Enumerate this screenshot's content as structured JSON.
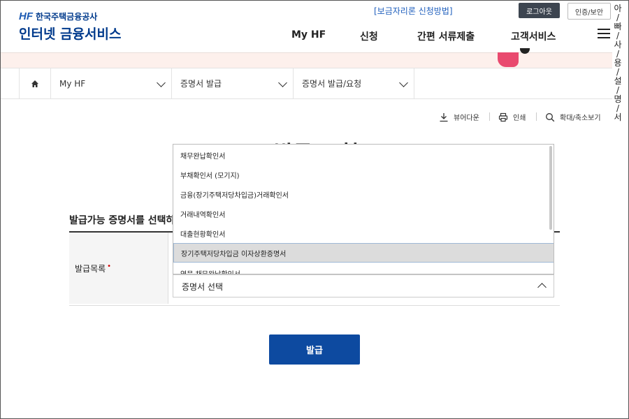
{
  "header": {
    "logo_mark": "HF",
    "org_name": "한국주택금융공사",
    "service_name": "인터넷 금융서비스",
    "top_link": "[보금자리론 신청방법]",
    "logout_label": "로그아웃",
    "cert_label": "인증/보안",
    "nav": [
      "My HF",
      "신청",
      "간편 서류제출",
      "고객서비스"
    ]
  },
  "side_vertical_text": [
    "아",
    "/",
    "빠",
    "/",
    "사",
    "/",
    "용",
    "/",
    "설",
    "/",
    "명",
    "/",
    "서"
  ],
  "breadcrumb": {
    "items": [
      "My HF",
      "증명서 발급",
      "증명서 발급/요청"
    ]
  },
  "utilities": {
    "download": "뷰어다운",
    "print": "인쇄",
    "zoom": "확대/축소보기"
  },
  "page_title": "발급/요청",
  "section_title": "발급가능 증명서를 선택하",
  "form": {
    "label": "발급목록",
    "required_mark": "•",
    "select_value": "증명서 선택"
  },
  "dropdown": {
    "options": [
      "채무완납확인서",
      "부채확인서 (모기지)",
      "금융(장기주택저당차입금)거래확인서",
      "거래내역확인서",
      "대출현황확인서",
      "장기주택저당차입금 이자상환증명서",
      "영문 채무완납확인서"
    ],
    "selected_index": 5
  },
  "issue_button": "발급"
}
